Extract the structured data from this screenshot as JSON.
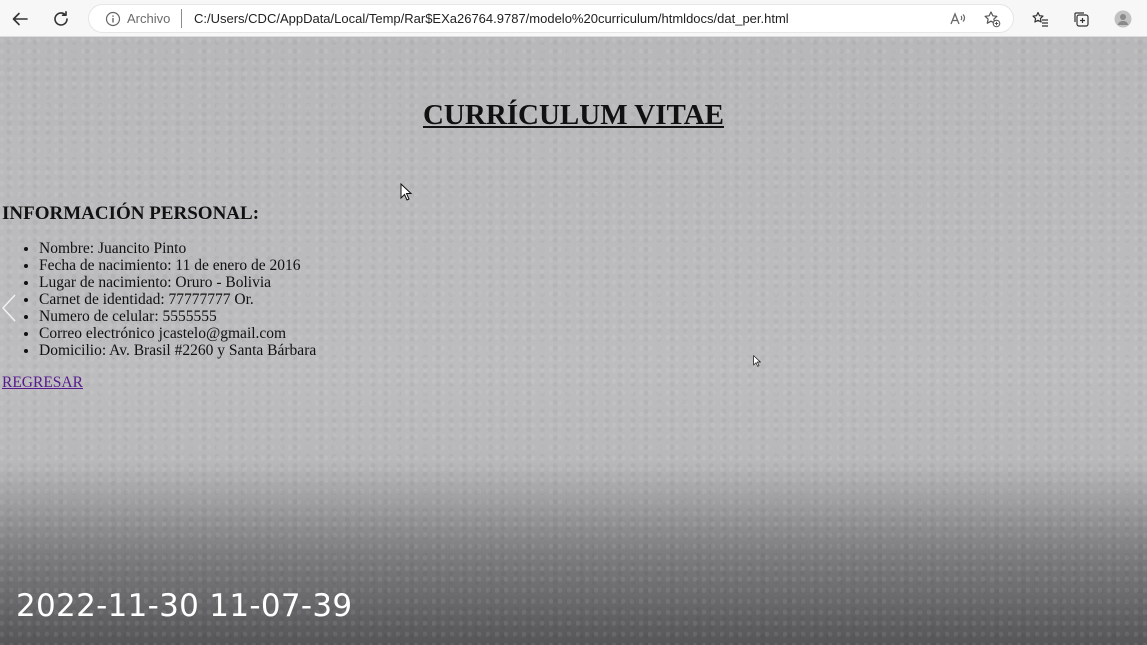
{
  "browser": {
    "address_scheme": "Archivo",
    "url": "C:/Users/CDC/AppData/Local/Temp/Rar$EXa26764.9787/modelo%20curriculum/htmldocs/dat_per.html",
    "icons": [
      "back-icon",
      "refresh-icon",
      "info-icon",
      "read-aloud-icon",
      "add-favorite-icon",
      "favorites-icon",
      "collections-icon",
      "profile-icon"
    ]
  },
  "page": {
    "title": "CURRÍCULUM VITAE",
    "section_heading": "INFORMACIÓN PERSONAL:",
    "items": [
      "Nombre: Juancito Pinto",
      "Fecha de nacimiento: 11 de enero de 2016",
      "Lugar de nacimiento: Oruro - Bolivia",
      "Carnet de identidad: 77777777 Or.",
      "Numero de celular: 5555555",
      "Correo electrónico jcastelo@gmail.com",
      "Domicilio: Av. Brasil #2260 y Santa Bárbara"
    ],
    "back_link": "REGRESAR"
  },
  "overlay": {
    "timestamp": "2022-11-30 11-07-39"
  }
}
